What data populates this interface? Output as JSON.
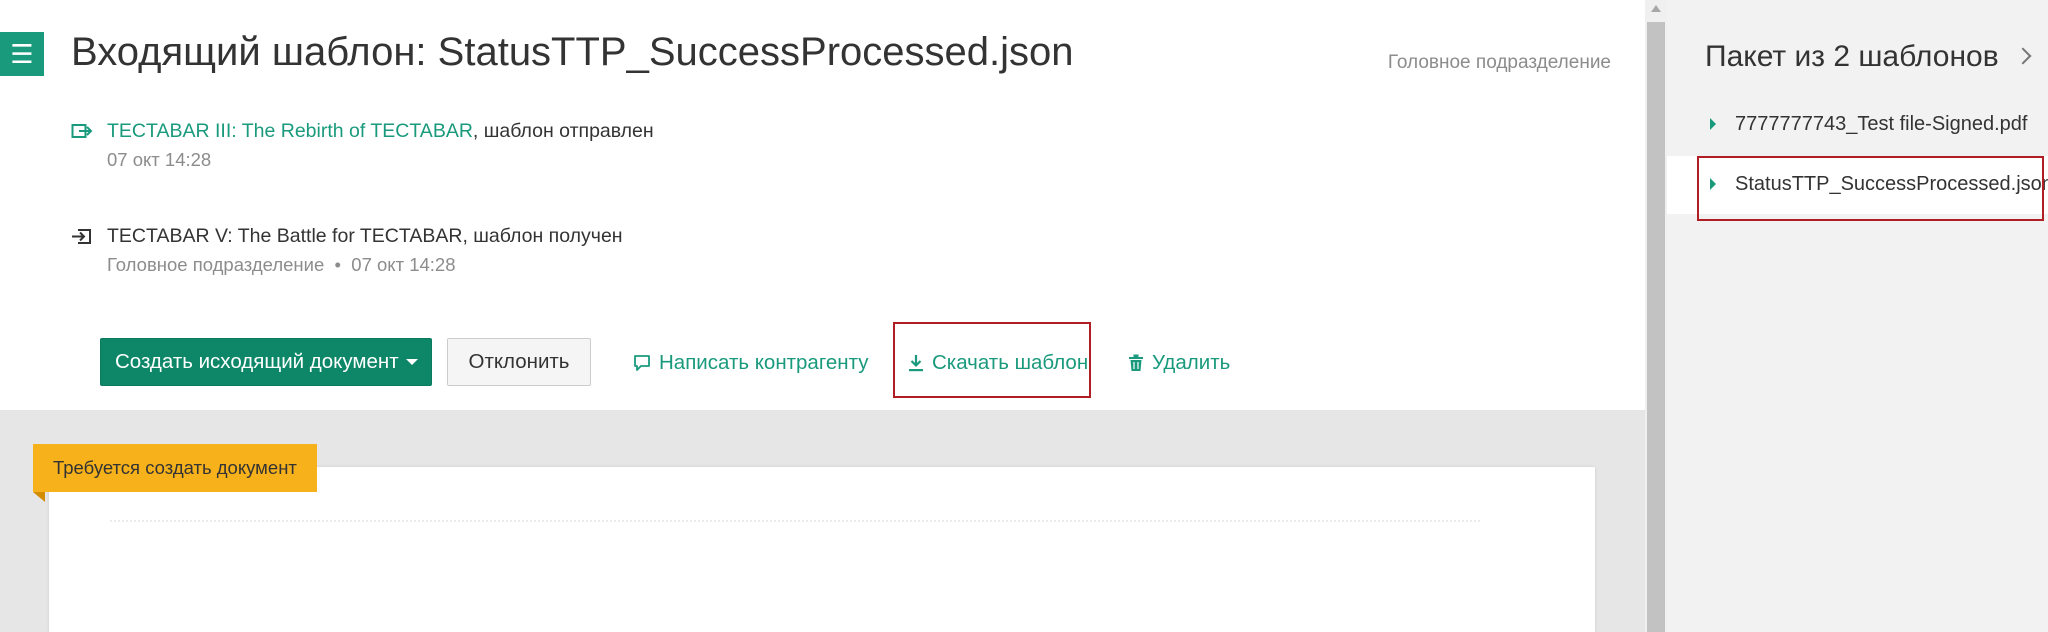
{
  "header": {
    "title": "Входящий шаблон: StatusTTP_SuccessProcessed.json",
    "organization": "Головное подразделение"
  },
  "events": [
    {
      "icon": "send-out-icon",
      "party": "TECTABAR III: The Rebirth of TECTABAR",
      "action": ", шаблон отправлен",
      "date": "07 окт 14:28"
    },
    {
      "icon": "receive-in-icon",
      "party": "TECTABAR V: The Battle for TECTABAR",
      "action": ", шаблон получен",
      "org": "Головное подразделение",
      "separator": "•",
      "date": "07 окт 14:28"
    }
  ],
  "actions": {
    "create_label": "Создать исходящий документ",
    "reject_label": "Отклонить",
    "write_label": "Написать контрагенту",
    "download_label": "Скачать шаблон",
    "delete_label": "Удалить"
  },
  "document": {
    "badge": "Требуется создать документ"
  },
  "sidebar": {
    "title": "Пакет из 2 шаблонов",
    "items": [
      {
        "label": "7777777743_Test file-Signed.pdf",
        "selected": false
      },
      {
        "label": "StatusTTP_SuccessProcessed.json",
        "selected": true
      }
    ]
  },
  "colors": {
    "accent": "#1a9a7d",
    "primary_button": "#0d8768",
    "badge": "#f7b21b",
    "highlight": "#b01e23"
  }
}
